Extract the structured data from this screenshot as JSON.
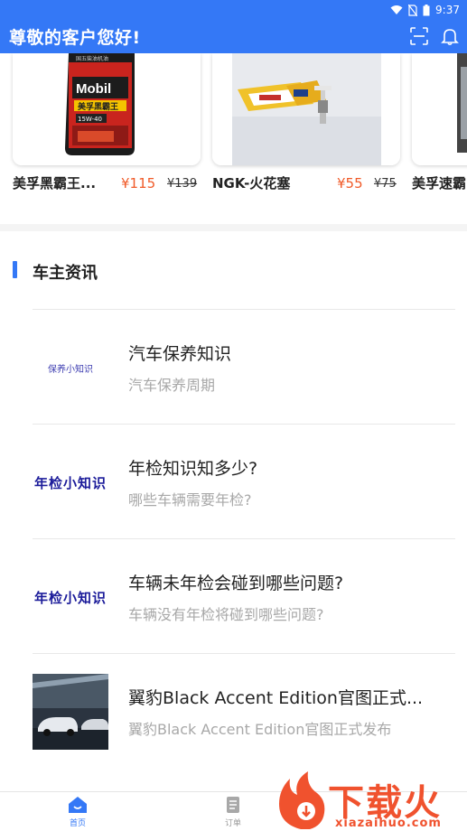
{
  "status": {
    "time": "9:37"
  },
  "header": {
    "title": "尊敬的客户您好!",
    "icons": [
      "scan-icon",
      "bell-icon"
    ]
  },
  "products": [
    {
      "name": "美孚黑霸王...",
      "price": "¥115",
      "old_price": "¥139"
    },
    {
      "name": "NGK-火花塞",
      "price": "¥55",
      "old_price": "¥75"
    },
    {
      "name": "美孚速霸"
    }
  ],
  "product_images": {
    "oil_label": "Mobil",
    "oil_sub": "美孚黑霸王",
    "oil_grade": "15W-40",
    "oil_top": "国五柴油机油"
  },
  "news": {
    "section_title": "车主资讯",
    "articles": [
      {
        "title": "汽车保养知识",
        "subtitle": "汽车保养周期",
        "thumb_text": "保养小知识"
      },
      {
        "title": "年检知识知多少?",
        "subtitle": "哪些车辆需要年检?",
        "thumb_text": "年检小知识"
      },
      {
        "title": "车辆未年检会碰到哪些问题?",
        "subtitle": "车辆没有年检将碰到哪些问题?",
        "thumb_text": "年检小知识"
      },
      {
        "title": "翼豹Black Accent Edition官图正式...",
        "subtitle": "翼豹Black Accent Edition官图正式发布"
      }
    ]
  },
  "tabbar": {
    "home": "首页",
    "orders": "订单"
  },
  "watermark": {
    "text": "下载火",
    "url": "xiazaihuo.com"
  },
  "colors": {
    "primary": "#3478f6",
    "price": "#f05a28",
    "watermark": "#f0522e"
  }
}
